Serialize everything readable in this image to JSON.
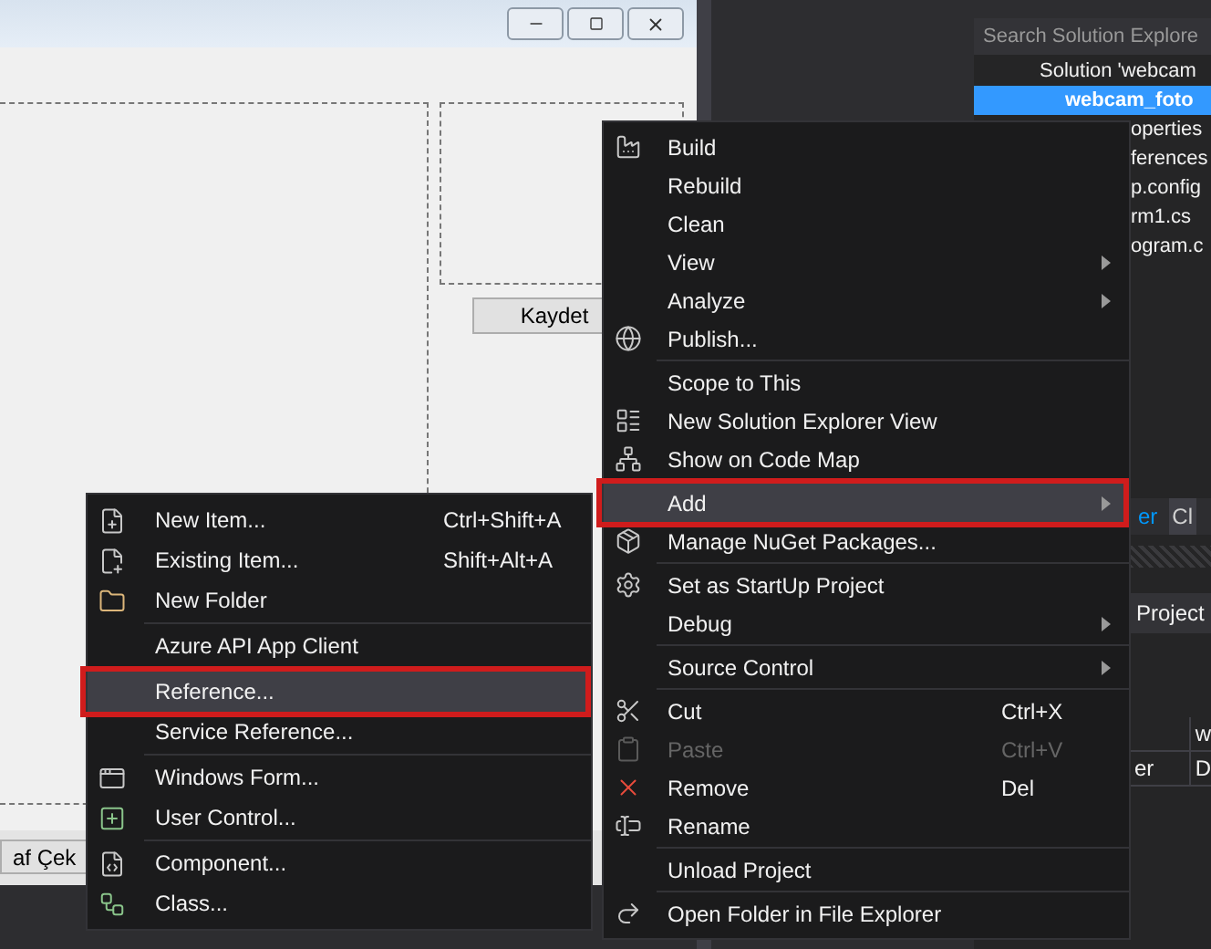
{
  "designer": {
    "save_button": "Kaydet",
    "capture_button": "af Çek"
  },
  "solution_explorer": {
    "search": {
      "placeholder": "Search Solution Explore"
    },
    "tree": [
      {
        "label": "Solution 'webcam",
        "selected": false,
        "children": [
          {
            "label": "webcam_foto",
            "selected": true,
            "children": [
              {
                "label": "operties",
                "selected": false
              },
              {
                "label": "ferences",
                "selected": false
              },
              {
                "label": "p.config",
                "selected": false
              },
              {
                "label": "rm1.cs",
                "selected": false
              },
              {
                "label": "ogram.c",
                "selected": false
              }
            ]
          }
        ]
      }
    ]
  },
  "panel_tabs": [
    {
      "label": "er",
      "selected": true
    },
    {
      "label": "Cl",
      "selected": false
    }
  ],
  "properties": {
    "object_label": "Project",
    "rows": [
      {
        "column_2": "w"
      },
      {
        "column_1": "er",
        "column_2": "D"
      }
    ]
  },
  "context_menu": {
    "groups": [
      [
        {
          "label": "Build",
          "submenu": false,
          "disabled": false,
          "highlighted": false,
          "annotated": false
        },
        {
          "label": "Rebuild",
          "submenu": false,
          "disabled": false,
          "highlighted": false,
          "annotated": false
        },
        {
          "label": "Clean",
          "submenu": false,
          "disabled": false,
          "highlighted": false,
          "annotated": false
        },
        {
          "label": "View",
          "submenu": true,
          "disabled": false,
          "highlighted": false,
          "annotated": false
        },
        {
          "label": "Analyze",
          "submenu": true,
          "disabled": false,
          "highlighted": false,
          "annotated": false
        },
        {
          "label": "Publish...",
          "submenu": false,
          "disabled": false,
          "highlighted": false,
          "annotated": false
        }
      ],
      [
        {
          "label": "Scope to This",
          "submenu": false,
          "disabled": false,
          "highlighted": false,
          "annotated": false
        },
        {
          "label": "New Solution Explorer View",
          "submenu": false,
          "disabled": false,
          "highlighted": false,
          "annotated": false
        },
        {
          "label": "Show on Code Map",
          "submenu": false,
          "disabled": false,
          "highlighted": false,
          "annotated": false
        }
      ],
      [
        {
          "label": "Add",
          "submenu": true,
          "disabled": false,
          "highlighted": true,
          "annotated": true
        },
        {
          "label": "Manage NuGet Packages...",
          "submenu": false,
          "disabled": false,
          "highlighted": false,
          "annotated": false
        }
      ],
      [
        {
          "label": "Set as StartUp Project",
          "submenu": false,
          "disabled": false,
          "highlighted": false,
          "annotated": false
        },
        {
          "label": "Debug",
          "submenu": true,
          "disabled": false,
          "highlighted": false,
          "annotated": false
        }
      ],
      [
        {
          "label": "Source Control",
          "submenu": true,
          "disabled": false,
          "highlighted": false,
          "annotated": false
        }
      ],
      [
        {
          "label": "Cut",
          "shortcut": "Ctrl+X",
          "submenu": false,
          "disabled": false,
          "highlighted": false,
          "annotated": false
        },
        {
          "label": "Paste",
          "shortcut": "Ctrl+V",
          "submenu": false,
          "disabled": true,
          "highlighted": false,
          "annotated": false
        },
        {
          "label": "Remove",
          "shortcut": "Del",
          "submenu": false,
          "disabled": false,
          "highlighted": false,
          "annotated": false
        },
        {
          "label": "Rename",
          "submenu": false,
          "disabled": false,
          "highlighted": false,
          "annotated": false
        }
      ],
      [
        {
          "label": "Unload Project",
          "submenu": false,
          "disabled": false,
          "highlighted": false,
          "annotated": false
        }
      ],
      [
        {
          "label": "Open Folder in File Explorer",
          "submenu": false,
          "disabled": false,
          "highlighted": false,
          "annotated": false
        }
      ]
    ]
  },
  "add_submenu": {
    "groups": [
      [
        {
          "label": "New Item...",
          "shortcut": "Ctrl+Shift+A",
          "highlighted": false,
          "annotated": false
        },
        {
          "label": "Existing Item...",
          "shortcut": "Shift+Alt+A",
          "highlighted": false,
          "annotated": false
        },
        {
          "label": "New Folder",
          "highlighted": false,
          "annotated": false
        }
      ],
      [
        {
          "label": "Azure API App Client",
          "highlighted": false,
          "annotated": false
        }
      ],
      [
        {
          "label": "Reference...",
          "highlighted": true,
          "annotated": true
        },
        {
          "label": "Service Reference...",
          "highlighted": false,
          "annotated": false
        }
      ],
      [
        {
          "label": "Windows Form...",
          "highlighted": false,
          "annotated": false
        },
        {
          "label": "User Control...",
          "highlighted": false,
          "annotated": false
        }
      ],
      [
        {
          "label": "Component...",
          "highlighted": false,
          "annotated": false
        },
        {
          "label": "Class...",
          "highlighted": false,
          "annotated": false
        }
      ]
    ]
  }
}
